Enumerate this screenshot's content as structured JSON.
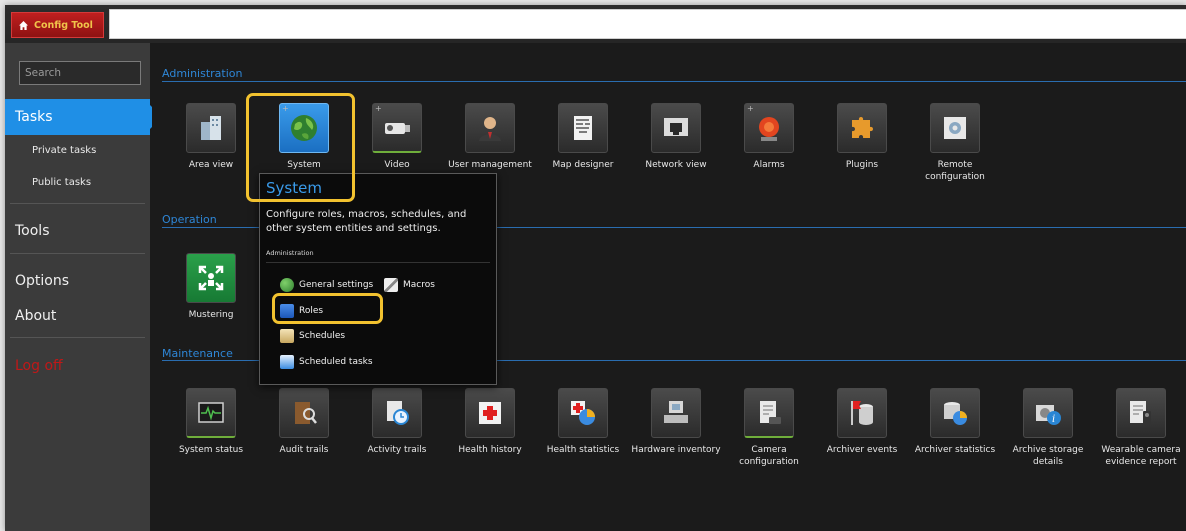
{
  "app": {
    "tab_label": "Config Tool"
  },
  "sidebar": {
    "search_placeholder": "Search",
    "tasks": "Tasks",
    "private_tasks": "Private tasks",
    "public_tasks": "Public tasks",
    "tools": "Tools",
    "options": "Options",
    "about": "About",
    "logoff": "Log off"
  },
  "sections": {
    "administration": "Administration",
    "operation": "Operation",
    "maintenance": "Maintenance"
  },
  "admin_tiles": [
    {
      "label": "Area view",
      "icon": "area-view-icon"
    },
    {
      "label": "System",
      "icon": "globe-icon"
    },
    {
      "label": "Video",
      "icon": "camera-icon"
    },
    {
      "label": "User management",
      "icon": "user-icon"
    },
    {
      "label": "Map designer",
      "icon": "map-icon"
    },
    {
      "label": "Network view",
      "icon": "network-icon"
    },
    {
      "label": "Alarms",
      "icon": "alarm-icon"
    },
    {
      "label": "Plugins",
      "icon": "puzzle-icon"
    },
    {
      "label": "Remote configuration",
      "icon": "remote-config-icon"
    }
  ],
  "operation_tiles": [
    {
      "label": "Mustering",
      "icon": "mustering-icon"
    }
  ],
  "maintenance_tiles": [
    {
      "label": "System status",
      "icon": "system-status-icon"
    },
    {
      "label": "Audit trails",
      "icon": "audit-trails-icon"
    },
    {
      "label": "Activity trails",
      "icon": "activity-trails-icon"
    },
    {
      "label": "Health history",
      "icon": "health-history-icon"
    },
    {
      "label": "Health statistics",
      "icon": "health-statistics-icon"
    },
    {
      "label": "Hardware inventory",
      "icon": "hardware-inventory-icon"
    },
    {
      "label": "Camera configuration",
      "icon": "camera-configuration-icon"
    },
    {
      "label": "Archiver events",
      "icon": "archiver-events-icon"
    },
    {
      "label": "Archiver statistics",
      "icon": "archiver-statistics-icon"
    },
    {
      "label": "Archive storage details",
      "icon": "archive-storage-icon"
    },
    {
      "label": "Wearable camera evidence report",
      "icon": "wearable-camera-icon"
    }
  ],
  "popup": {
    "title": "System",
    "description": "Configure roles, macros, schedules, and other system entities and settings.",
    "section": "Administration",
    "items": {
      "general_settings": "General settings",
      "macros": "Macros",
      "roles": "Roles",
      "schedules": "Schedules",
      "scheduled_tasks": "Scheduled tasks"
    }
  },
  "colors": {
    "accent": "#1f8fe6",
    "highlight": "#f2c22f",
    "tab": "#b01a1a",
    "logoff": "#c01818"
  }
}
